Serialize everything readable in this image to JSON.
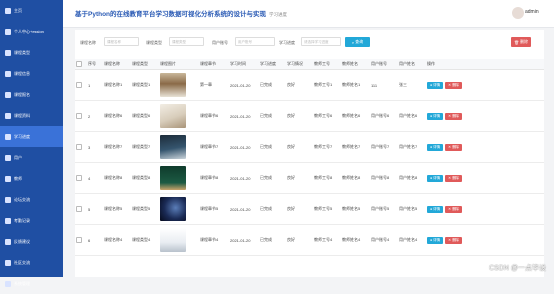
{
  "sidebar": {
    "items": [
      {
        "label": "主页",
        "active": false
      },
      {
        "label": "个人中心+ession",
        "active": false
      },
      {
        "label": "课程类型",
        "active": false
      },
      {
        "label": "课程信息",
        "active": false
      },
      {
        "label": "课程报名",
        "active": false
      },
      {
        "label": "课程资料",
        "active": false
      },
      {
        "label": "学习进度",
        "active": true
      },
      {
        "label": "用户",
        "active": false
      },
      {
        "label": "教师",
        "active": false
      },
      {
        "label": "论坛交流",
        "active": false
      },
      {
        "label": "考勤记录",
        "active": false
      },
      {
        "label": "反馈建议",
        "active": false
      },
      {
        "label": "社区交流",
        "active": false
      },
      {
        "label": "系统管理",
        "active": false
      }
    ]
  },
  "header": {
    "title": "基于Python的在线教育平台学习数据可视化分析系统的设计与实现",
    "breadcrumb": "学习进度",
    "user": "admin"
  },
  "search": {
    "fields": [
      {
        "label": "课程名称",
        "placeholder": "课程名称"
      },
      {
        "label": "课程类型",
        "placeholder": "课程类型"
      },
      {
        "label": "用户账号",
        "placeholder": "用户账号"
      },
      {
        "label": "学习进度",
        "placeholder": "请选择学习进度"
      }
    ],
    "search_label": "查询",
    "delete_label": "删除"
  },
  "table": {
    "columns": [
      "",
      "序号",
      "课程名称",
      "课程类型",
      "课程图片",
      "课程章节",
      "学习时间",
      "学习进度",
      "学习情况",
      "教师工号",
      "教师姓名",
      "用户账号",
      "用户姓名",
      "操作"
    ],
    "rows": [
      {
        "idx": "1",
        "name": "课程名称1",
        "type": "课程类型1",
        "chapter": "第一章",
        "time": "2021-01-20",
        "progress": "已完成",
        "status": "良好",
        "tno": "教师工号1",
        "tname": "教师姓名1",
        "uacc": "111",
        "uname": "张三",
        "img": "library"
      },
      {
        "idx": "2",
        "name": "课程名称6",
        "type": "课程类型6",
        "chapter": "课程章节6",
        "time": "2021-01-20",
        "progress": "已完成",
        "status": "良好",
        "tno": "教师工号6",
        "tname": "教师姓名6",
        "uacc": "用户账号6",
        "uname": "用户姓名6",
        "img": "book"
      },
      {
        "idx": "3",
        "name": "课程名称7",
        "type": "课程类型7",
        "chapter": "课程章节7",
        "time": "2021-01-20",
        "progress": "已完成",
        "status": "良好",
        "tno": "教师工号7",
        "tname": "教师姓名7",
        "uacc": "用户账号7",
        "uname": "用户姓名7",
        "img": "classroom"
      },
      {
        "idx": "4",
        "name": "课程名称8",
        "type": "课程类型8",
        "chapter": "课程章节8",
        "time": "2021-01-20",
        "progress": "已完成",
        "status": "良好",
        "tno": "教师工号8",
        "tname": "教师姓名8",
        "uacc": "用户账号8",
        "uname": "用户姓名8",
        "img": "blackboard"
      },
      {
        "idx": "5",
        "name": "课程名称5",
        "type": "课程类型5",
        "chapter": "课程章节5",
        "time": "2021-01-20",
        "progress": "已完成",
        "status": "良好",
        "tno": "教师工号5",
        "tname": "教师姓名5",
        "uacc": "用户账号5",
        "uname": "用户姓名5",
        "img": "space"
      },
      {
        "idx": "6",
        "name": "课程名称4",
        "type": "课程类型4",
        "chapter": "课程章节4",
        "time": "2021-01-20",
        "progress": "已完成",
        "status": "良好",
        "tno": "教师工号4",
        "tname": "教师姓名4",
        "uacc": "用户账号4",
        "uname": "用户姓名4",
        "img": "desk"
      }
    ],
    "detail_label": "详情",
    "delete_label": "删除"
  },
  "colors": {
    "sidebar": "#1f4fa3",
    "sidebar_active": "#3a72d8",
    "title": "#2b5bb5",
    "info_button": "#22a8d8",
    "danger_button": "#e05a5a"
  },
  "watermark": "CSDN @一点毕设"
}
